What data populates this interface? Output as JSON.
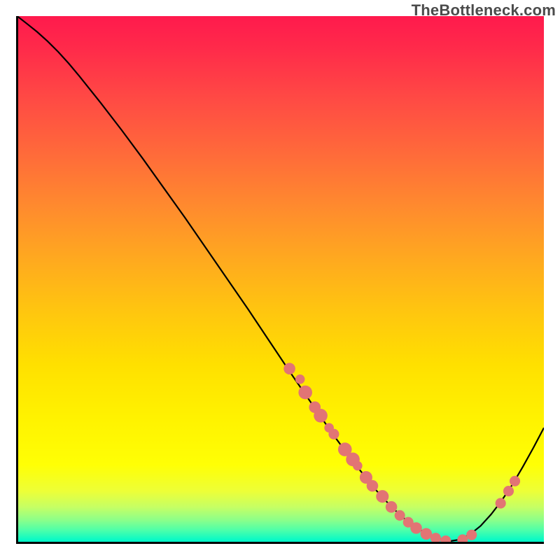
{
  "watermark": "TheBottleneck.com",
  "chart_data": {
    "type": "line",
    "title": "",
    "xlabel": "",
    "ylabel": "",
    "xlim": [
      0,
      100
    ],
    "ylim": [
      0,
      100
    ],
    "series": [
      {
        "name": "curve",
        "x": [
          0.2,
          2,
          4,
          6,
          8,
          10,
          12,
          16,
          20,
          24,
          28,
          32,
          36,
          40,
          44,
          48,
          52,
          56,
          60,
          64,
          68,
          70,
          72,
          74,
          76,
          78,
          80,
          82,
          84,
          86,
          88,
          90,
          92,
          94,
          96,
          98,
          100
        ],
        "y": [
          100,
          98.6,
          97.0,
          95.2,
          93.2,
          91.0,
          88.6,
          83.6,
          78.4,
          73.0,
          67.4,
          61.8,
          56.0,
          50.2,
          44.4,
          38.4,
          32.4,
          26.6,
          20.8,
          15.4,
          10.4,
          8.2,
          6.2,
          4.4,
          3.0,
          1.8,
          1.0,
          0.5,
          0.8,
          1.8,
          3.4,
          5.6,
          8.2,
          11.2,
          14.6,
          18.2,
          22.0
        ]
      }
    ],
    "markers": [
      {
        "x": 51.8,
        "y": 33.2,
        "r": 1.1
      },
      {
        "x": 53.8,
        "y": 31.2,
        "r": 0.9
      },
      {
        "x": 54.8,
        "y": 28.7,
        "r": 1.3
      },
      {
        "x": 56.6,
        "y": 25.9,
        "r": 1.1
      },
      {
        "x": 57.7,
        "y": 24.3,
        "r": 1.3
      },
      {
        "x": 59.3,
        "y": 22.0,
        "r": 0.9
      },
      {
        "x": 60.2,
        "y": 20.8,
        "r": 1.0
      },
      {
        "x": 62.3,
        "y": 17.9,
        "r": 1.3
      },
      {
        "x": 63.8,
        "y": 16.0,
        "r": 1.3
      },
      {
        "x": 64.7,
        "y": 14.8,
        "r": 0.9
      },
      {
        "x": 66.3,
        "y": 12.6,
        "r": 1.2
      },
      {
        "x": 67.5,
        "y": 11.0,
        "r": 1.1
      },
      {
        "x": 69.4,
        "y": 9.0,
        "r": 1.2
      },
      {
        "x": 71.1,
        "y": 7.0,
        "r": 1.1
      },
      {
        "x": 72.7,
        "y": 5.4,
        "r": 1.0
      },
      {
        "x": 74.3,
        "y": 4.1,
        "r": 1.0
      },
      {
        "x": 75.8,
        "y": 3.0,
        "r": 1.1
      },
      {
        "x": 77.7,
        "y": 1.9,
        "r": 1.1
      },
      {
        "x": 79.5,
        "y": 1.1,
        "r": 1.0
      },
      {
        "x": 81.4,
        "y": 0.6,
        "r": 1.0
      },
      {
        "x": 84.6,
        "y": 0.8,
        "r": 1.0
      },
      {
        "x": 86.3,
        "y": 1.7,
        "r": 1.0
      },
      {
        "x": 91.8,
        "y": 7.7,
        "r": 1.0
      },
      {
        "x": 93.3,
        "y": 10.0,
        "r": 1.0
      },
      {
        "x": 94.5,
        "y": 11.9,
        "r": 1.0
      }
    ],
    "marker_color": "#e27474",
    "curve_color": "#000000"
  }
}
